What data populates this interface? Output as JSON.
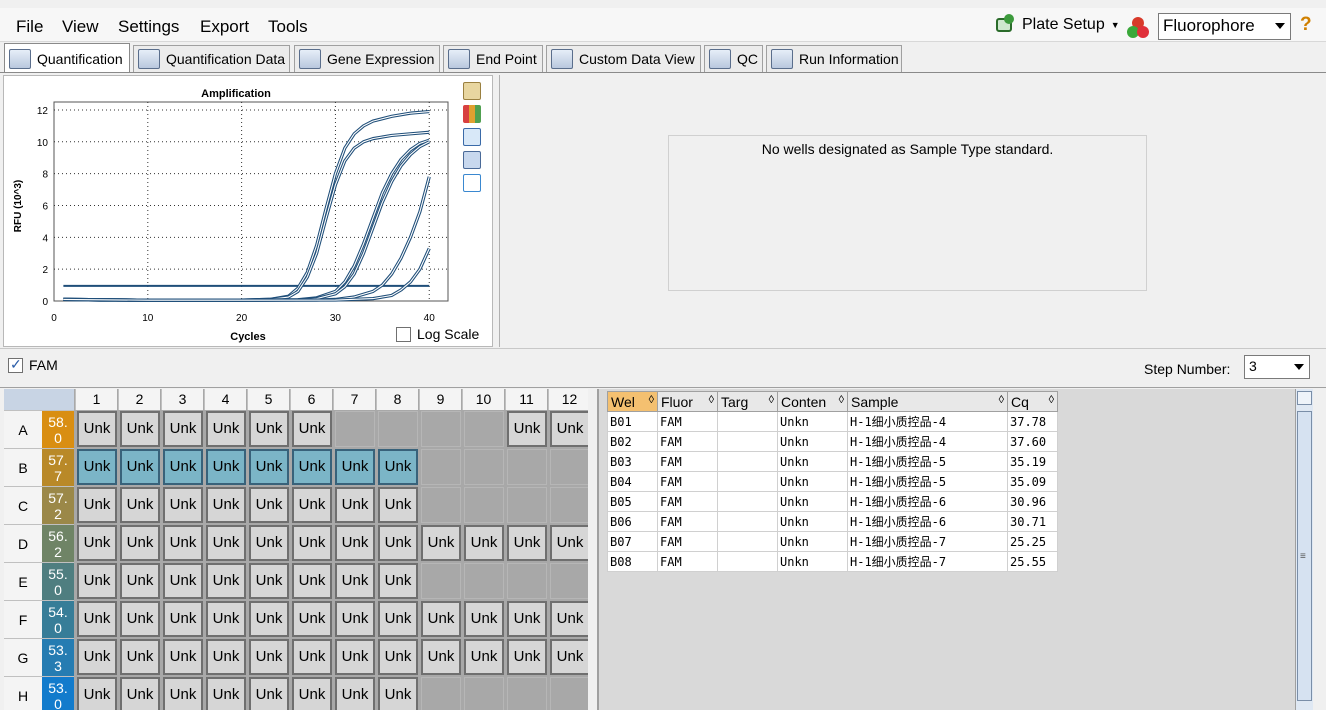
{
  "menu": [
    "File",
    "View",
    "Settings",
    "Export",
    "Tools"
  ],
  "toolbar": {
    "plate_setup_label": "Plate Setup",
    "fluorophore_value": "Fluorophore",
    "help_label": "?"
  },
  "tabs": [
    "Quantification",
    "Quantification Data",
    "Gene Expression",
    "End Point",
    "Custom Data View",
    "QC",
    "Run Information"
  ],
  "chart": {
    "title": "Amplification",
    "xlabel": "Cycles",
    "ylabel": "RFU (10^3)",
    "log_scale_label": "Log Scale",
    "x_ticks": [
      "0",
      "10",
      "20",
      "30",
      "40"
    ],
    "y_ticks": [
      "0",
      "2",
      "4",
      "6",
      "8",
      "10",
      "12"
    ]
  },
  "chart_data": {
    "type": "line",
    "title": "Amplification",
    "xlabel": "Cycles",
    "ylabel": "RFU (10^3)",
    "xlim": [
      0,
      42
    ],
    "ylim": [
      0,
      12.5
    ],
    "grid": true,
    "threshold": 0.95,
    "series": [
      {
        "x": [
          1,
          5,
          10,
          15,
          20,
          23,
          25,
          26,
          27,
          28,
          29,
          30,
          31,
          32,
          33,
          34,
          36,
          38,
          40
        ],
        "values": [
          0.1,
          0.05,
          0.05,
          0.05,
          0.06,
          0.1,
          0.3,
          0.8,
          1.8,
          3.5,
          5.8,
          8.0,
          9.6,
          10.5,
          11.0,
          11.3,
          11.6,
          11.8,
          11.9
        ]
      },
      {
        "x": [
          1,
          5,
          10,
          15,
          20,
          23,
          25,
          26,
          27,
          28,
          29,
          30,
          31,
          32,
          33,
          34,
          36,
          38,
          40
        ],
        "values": [
          0.1,
          0.05,
          0.05,
          0.05,
          0.06,
          0.1,
          0.25,
          0.6,
          1.5,
          3.0,
          5.2,
          7.3,
          8.8,
          9.6,
          10.0,
          10.2,
          10.4,
          10.5,
          10.6
        ]
      },
      {
        "x": [
          1,
          10,
          20,
          26,
          28,
          30,
          31,
          32,
          33,
          34,
          35,
          36,
          37,
          38,
          39,
          40
        ],
        "values": [
          0.1,
          0.05,
          0.05,
          0.08,
          0.2,
          0.6,
          1.2,
          2.2,
          3.6,
          5.2,
          6.8,
          8.0,
          8.9,
          9.5,
          9.9,
          10.1
        ]
      },
      {
        "x": [
          1,
          10,
          20,
          26,
          28,
          30,
          31,
          32,
          33,
          34,
          35,
          36,
          37,
          38,
          39,
          40
        ],
        "values": [
          0.1,
          0.05,
          0.05,
          0.07,
          0.15,
          0.45,
          0.9,
          1.7,
          3.0,
          4.6,
          6.2,
          7.5,
          8.5,
          9.2,
          9.7,
          10.0
        ]
      },
      {
        "x": [
          1,
          10,
          20,
          28,
          30,
          32,
          34,
          35,
          36,
          37,
          38,
          39,
          40
        ],
        "values": [
          0.1,
          0.05,
          0.05,
          0.06,
          0.1,
          0.25,
          0.6,
          1.0,
          1.7,
          2.7,
          4.0,
          5.6,
          7.8
        ]
      },
      {
        "x": [
          1,
          10,
          20,
          30,
          34,
          36,
          37,
          38,
          39,
          40
        ],
        "values": [
          0.1,
          0.05,
          0.05,
          0.06,
          0.15,
          0.35,
          0.7,
          1.2,
          2.0,
          3.3
        ]
      }
    ]
  },
  "std_message": "No wells designated as Sample Type standard.",
  "fam_label": "FAM",
  "step": {
    "label": "Step Number:",
    "value": "3"
  },
  "plate": {
    "cols": [
      "1",
      "2",
      "3",
      "4",
      "5",
      "6",
      "7",
      "8",
      "9",
      "10",
      "11",
      "12"
    ],
    "rows": [
      {
        "label": "A",
        "temp": "58.0",
        "temp_top": "58.",
        "temp_bot": "0",
        "color": "#d98e12",
        "wells": [
          "Unk",
          "Unk",
          "Unk",
          "Unk",
          "Unk",
          "Unk",
          "",
          "",
          "",
          "",
          "Unk",
          "Unk"
        ],
        "highlight": false
      },
      {
        "label": "B",
        "temp": "57.7",
        "temp_top": "57.",
        "temp_bot": "7",
        "color": "#b98928",
        "wells": [
          "Unk",
          "Unk",
          "Unk",
          "Unk",
          "Unk",
          "Unk",
          "Unk",
          "Unk",
          "",
          "",
          "",
          ""
        ],
        "highlight": true
      },
      {
        "label": "C",
        "temp": "57.2",
        "temp_top": "57.",
        "temp_bot": "2",
        "color": "#9b8848",
        "wells": [
          "Unk",
          "Unk",
          "Unk",
          "Unk",
          "Unk",
          "Unk",
          "Unk",
          "Unk",
          "",
          "",
          "",
          ""
        ],
        "highlight": false
      },
      {
        "label": "D",
        "temp": "56.2",
        "temp_top": "56.",
        "temp_bot": "2",
        "color": "#6f8466",
        "wells": [
          "Unk",
          "Unk",
          "Unk",
          "Unk",
          "Unk",
          "Unk",
          "Unk",
          "Unk",
          "Unk",
          "Unk",
          "Unk",
          "Unk"
        ],
        "highlight": false
      },
      {
        "label": "E",
        "temp": "55.0",
        "temp_top": "55.",
        "temp_bot": "0",
        "color": "#4f7e80",
        "wells": [
          "Unk",
          "Unk",
          "Unk",
          "Unk",
          "Unk",
          "Unk",
          "Unk",
          "Unk",
          "",
          "",
          "",
          ""
        ],
        "highlight": false
      },
      {
        "label": "F",
        "temp": "54.0",
        "temp_top": "54.",
        "temp_bot": "0",
        "color": "#377d98",
        "wells": [
          "Unk",
          "Unk",
          "Unk",
          "Unk",
          "Unk",
          "Unk",
          "Unk",
          "Unk",
          "Unk",
          "Unk",
          "Unk",
          "Unk"
        ],
        "highlight": false
      },
      {
        "label": "G",
        "temp": "53.3",
        "temp_top": "53.",
        "temp_bot": "3",
        "color": "#257cb2",
        "wells": [
          "Unk",
          "Unk",
          "Unk",
          "Unk",
          "Unk",
          "Unk",
          "Unk",
          "Unk",
          "Unk",
          "Unk",
          "Unk",
          "Unk"
        ],
        "highlight": false
      },
      {
        "label": "H",
        "temp": "53.0",
        "temp_top": "53.",
        "temp_bot": "0",
        "color": "#127bcc",
        "wells": [
          "Unk",
          "Unk",
          "Unk",
          "Unk",
          "Unk",
          "Unk",
          "Unk",
          "Unk",
          "",
          "",
          "",
          ""
        ],
        "highlight": false
      }
    ]
  },
  "table": {
    "headers": [
      "Wel\nl",
      "Fluor",
      "Targ\net",
      "Conten\nt",
      "Sample",
      "Cq"
    ],
    "header_labels": [
      "Wel",
      "Fluor",
      "Targ",
      "Conten",
      "Sample",
      "Cq"
    ],
    "rows": [
      [
        "B01",
        "FAM",
        "",
        "Unkn",
        "H-1细小质控品-4",
        "37.78"
      ],
      [
        "B02",
        "FAM",
        "",
        "Unkn",
        "H-1细小质控品-4",
        "37.60"
      ],
      [
        "B03",
        "FAM",
        "",
        "Unkn",
        "H-1细小质控品-5",
        "35.19"
      ],
      [
        "B04",
        "FAM",
        "",
        "Unkn",
        "H-1细小质控品-5",
        "35.09"
      ],
      [
        "B05",
        "FAM",
        "",
        "Unkn",
        "H-1细小质控品-6",
        "30.96"
      ],
      [
        "B06",
        "FAM",
        "",
        "Unkn",
        "H-1细小质控品-6",
        "30.71"
      ],
      [
        "B07",
        "FAM",
        "",
        "Unkn",
        "H-1细小质控品-7",
        "25.25"
      ],
      [
        "B08",
        "FAM",
        "",
        "Unkn",
        "H-1细小质控品-7",
        "25.55"
      ]
    ]
  },
  "colors": {
    "curve": "#1f4e79",
    "threshold": "#1f4e79",
    "accent_sort": "#f4c070",
    "highlight_well": "#7bb5c7"
  }
}
